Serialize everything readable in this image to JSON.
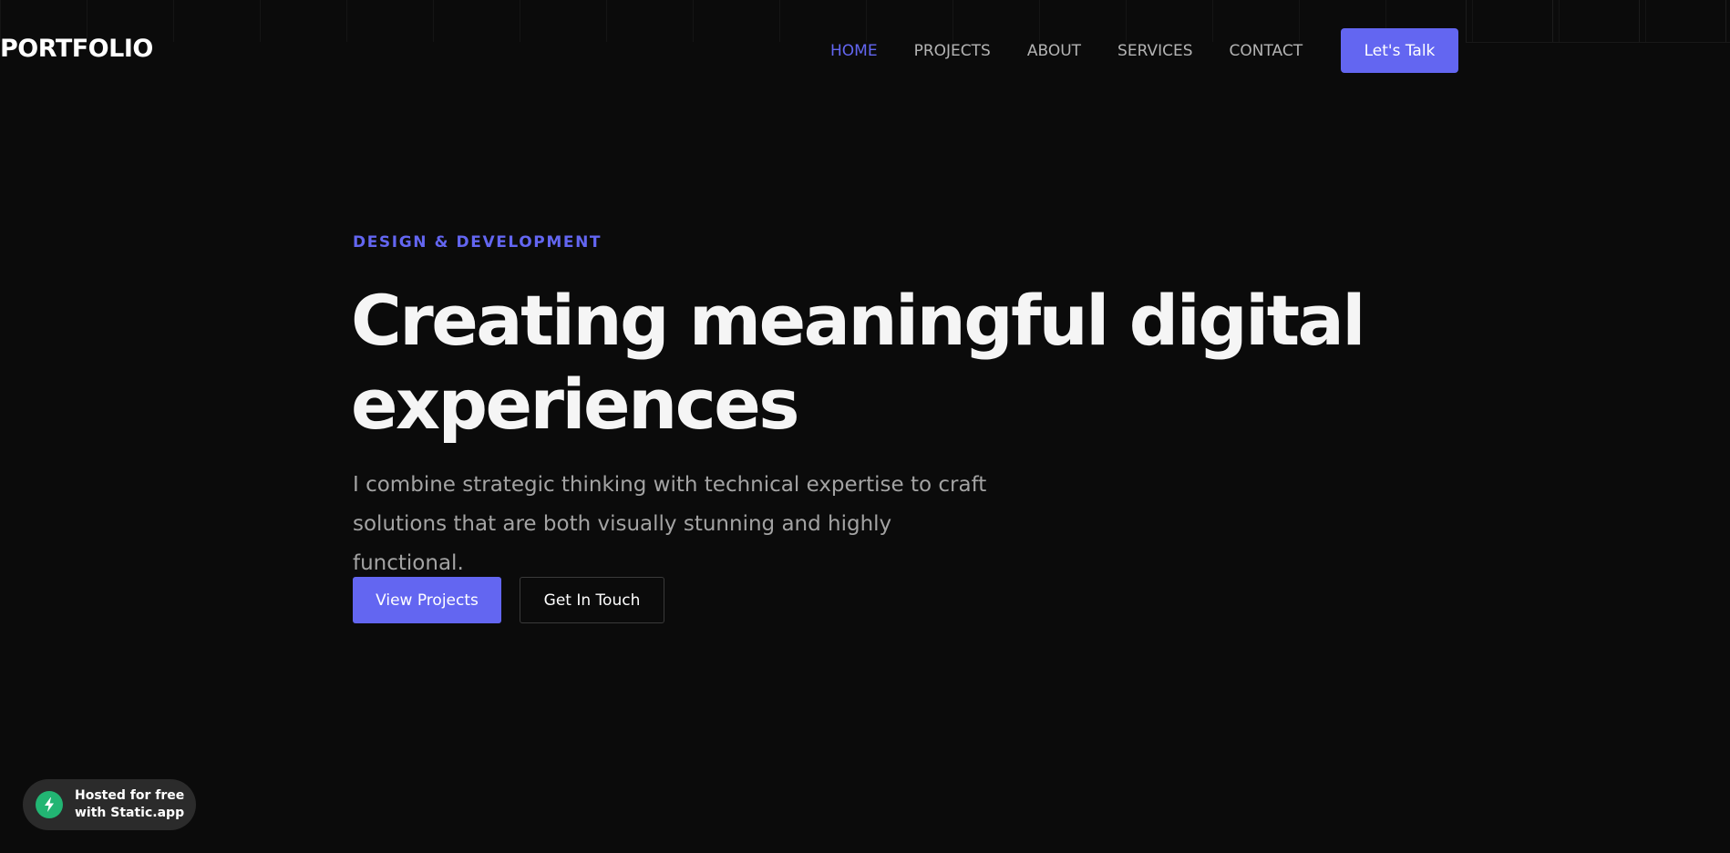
{
  "header": {
    "logo": "PORTFOLIO",
    "nav": [
      {
        "label": "HOME",
        "active": true
      },
      {
        "label": "PROJECTS",
        "active": false
      },
      {
        "label": "ABOUT",
        "active": false
      },
      {
        "label": "SERVICES",
        "active": false
      },
      {
        "label": "CONTACT",
        "active": false
      }
    ],
    "cta_label": "Let's Talk"
  },
  "hero": {
    "eyebrow": "DESIGN & DEVELOPMENT",
    "headline_line1": "Creating meaningful digital",
    "headline_line2": "experiences",
    "subtext_line1": "I combine strategic thinking with technical expertise to craft",
    "subtext_line2": "solutions that are both visually stunning and highly functional.",
    "primary_button": "View Projects",
    "secondary_button": "Get In Touch"
  },
  "badge": {
    "line1": "Hosted for free",
    "line2": "with Static.app",
    "icon": "lightning-icon"
  },
  "colors": {
    "background": "#0b0b0b",
    "accent": "#6366f1",
    "text": "#ffffff",
    "muted": "#a3a3a3",
    "badge_icon": "#22b573"
  }
}
